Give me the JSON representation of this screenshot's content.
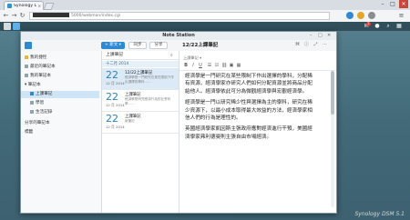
{
  "browser": {
    "tab_title": "Synology DiskStation",
    "url_path": "5000/webman/index.cgi"
  },
  "dsm": {
    "watermark": "Synology DSM 5.1",
    "notification_count": "2"
  },
  "app": {
    "title": "Note Station",
    "new_label": "+ 新文 ▾",
    "sync_label": "同步",
    "share_label": "分享"
  },
  "sidebar": {
    "items": [
      {
        "label": "我的捷徑"
      },
      {
        "label": "最近的筆記本"
      },
      {
        "label": "我的筆記本"
      },
      {
        "label": "筆記本"
      },
      {
        "label": "上課筆記"
      },
      {
        "label": "學習"
      },
      {
        "label": "生活記錄"
      },
      {
        "label": "分享的筆記本"
      },
      {
        "label": "標籤"
      }
    ]
  },
  "notelist": {
    "header": "上課筆記",
    "month": "十二月 2014",
    "notes": [
      {
        "day": "22",
        "month": "12 月 2014",
        "title": "12/22上課筆記",
        "snippet": "經濟學是一門研究在某些限制下作出選擇的學科……"
      },
      {
        "day": "22",
        "month": "12 月 2014",
        "title": "上課筆記",
        "snippet": "經濟學是研究經濟行為的社會科學……"
      },
      {
        "day": "22",
        "month": "12 月 2014",
        "title": "上課筆記",
        "snippet": "新筆記"
      }
    ]
  },
  "editor": {
    "title": "12/22上課筆記",
    "meta": "上課筆記 ▾",
    "paragraphs": [
      "經濟學是一門研究在某些限制下作出選擇的學科，分配稀有資源，經濟學家亦研究人們如何分配資源並將商品分配給他人。經濟學依此可分為微觀經濟學與宏觀經濟學。",
      "經濟學是一門以研究稀少性與選擇為主的學科，研究在稀少資源下，以最小成本取得最大效益的方法，經濟學家相信人們的行為是理性的。",
      "英國經濟學家凱因斯主張政府應對經濟進行干預，美國經濟學家弗利德曼則主張自由市場經濟。"
    ]
  }
}
